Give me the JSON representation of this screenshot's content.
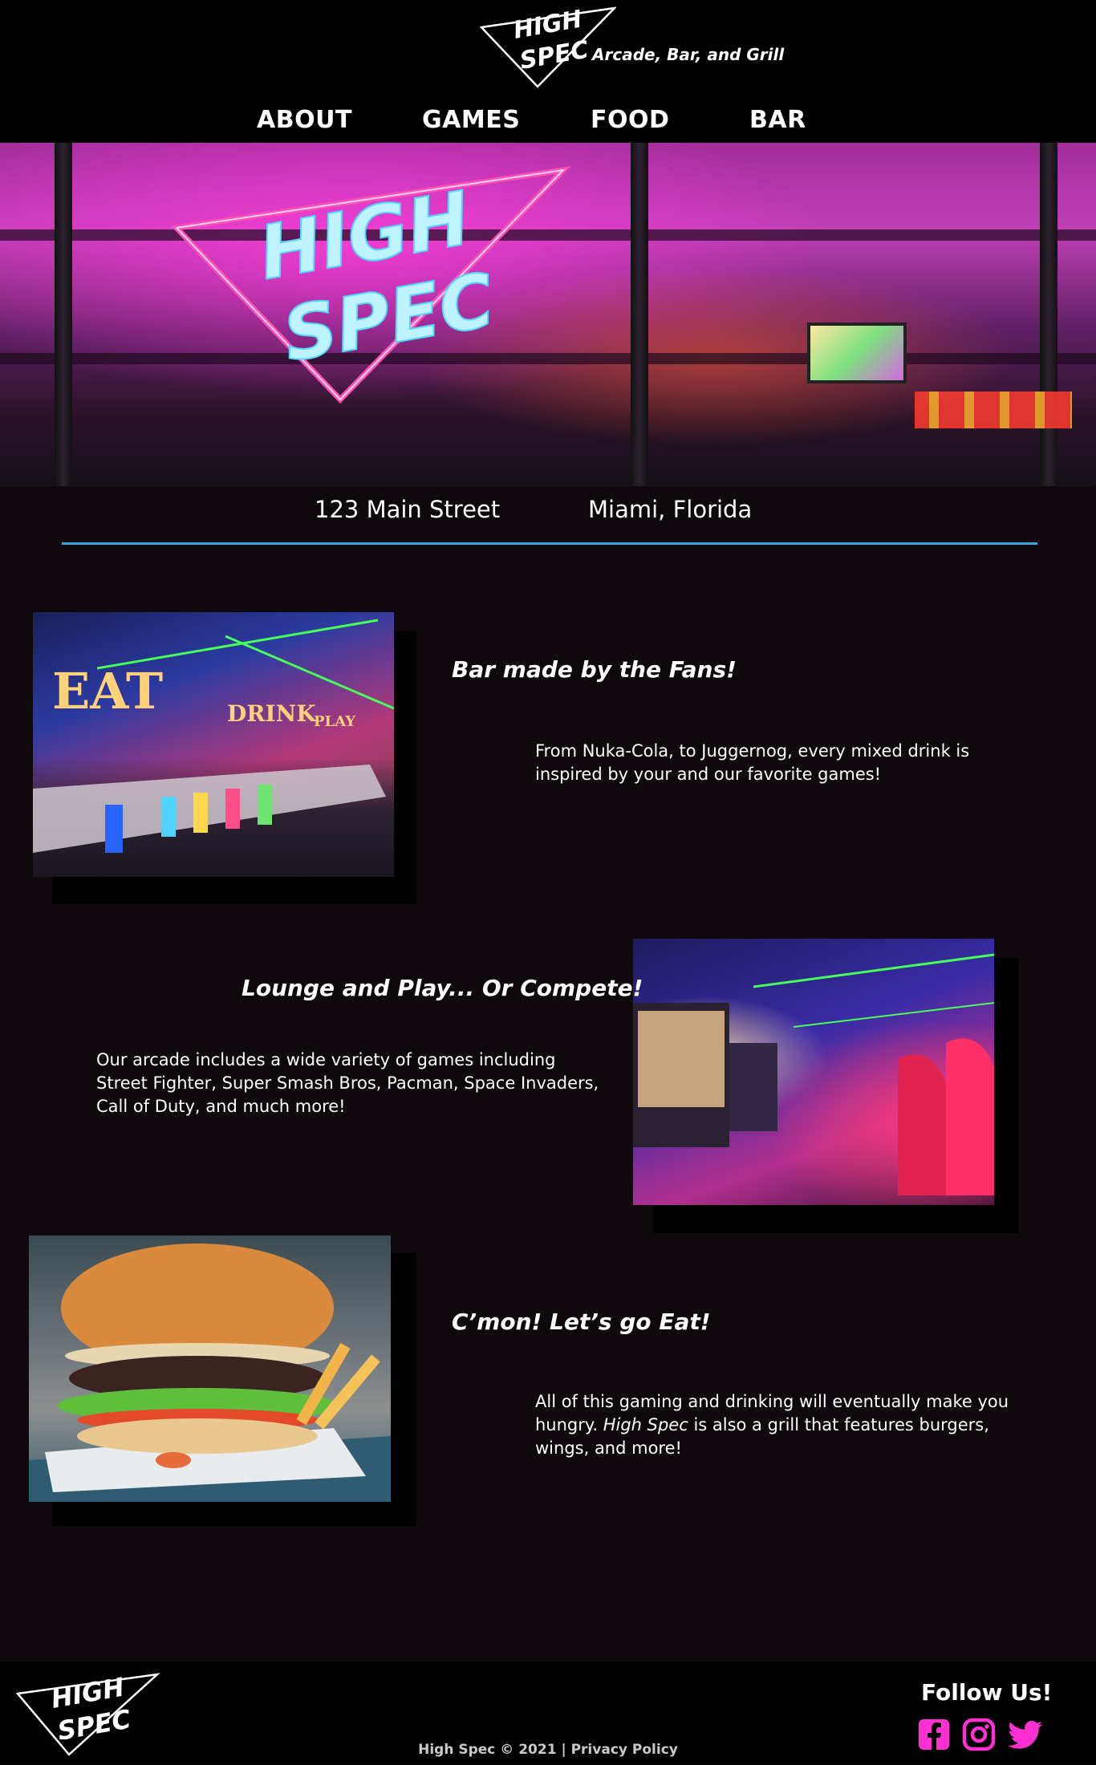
{
  "header": {
    "logo_line1": "HIGH",
    "logo_line2": "SPEC",
    "tagline": "Arcade, Bar, and Grill"
  },
  "nav": {
    "items": [
      {
        "label": "ABOUT"
      },
      {
        "label": "GAMES"
      },
      {
        "label": "FOOD"
      },
      {
        "label": "BAR"
      }
    ]
  },
  "hero": {
    "sign_line1": "HIGH",
    "sign_line2": "SPEC"
  },
  "address": {
    "street": "123 Main Street",
    "city": "Miami, Florida"
  },
  "sections": [
    {
      "title": "Bar made by the Fans!",
      "body": "From Nuka-Cola, to Juggernog, every mixed drink is inspired by your and our favorite games!",
      "sign_eat": "EAT",
      "sign_drink": "DRINK",
      "sign_play": "PLAY"
    },
    {
      "title": "Lounge and Play... Or Compete!",
      "body": "Our arcade includes a wide variety of games including Street Fighter, Super Smash Bros, Pacman, Space Invaders, Call of Duty, and much more!"
    },
    {
      "title": "C’mon! Let’s go Eat!",
      "body_before": "All of this gaming and drinking will eventually make you hungry. ",
      "body_em": "High Spec",
      "body_after": " is also a grill that features burgers, wings, and more!"
    }
  ],
  "footer": {
    "logo_line1": "HIGH",
    "logo_line2": "SPEC",
    "follow": "Follow Us!",
    "copyright": "High Spec © 2021",
    "separator": " | ",
    "privacy": "Privacy Policy",
    "social": [
      {
        "icon": "facebook-icon",
        "color": "#ff2fd1"
      },
      {
        "icon": "instagram-icon",
        "color": "#ff2fd1"
      },
      {
        "icon": "twitter-icon",
        "color": "#ff2fd1"
      }
    ]
  },
  "colors": {
    "accent_pink": "#ff2fd1",
    "divider_blue": "#3aa8e0",
    "background": "#0f090e"
  }
}
